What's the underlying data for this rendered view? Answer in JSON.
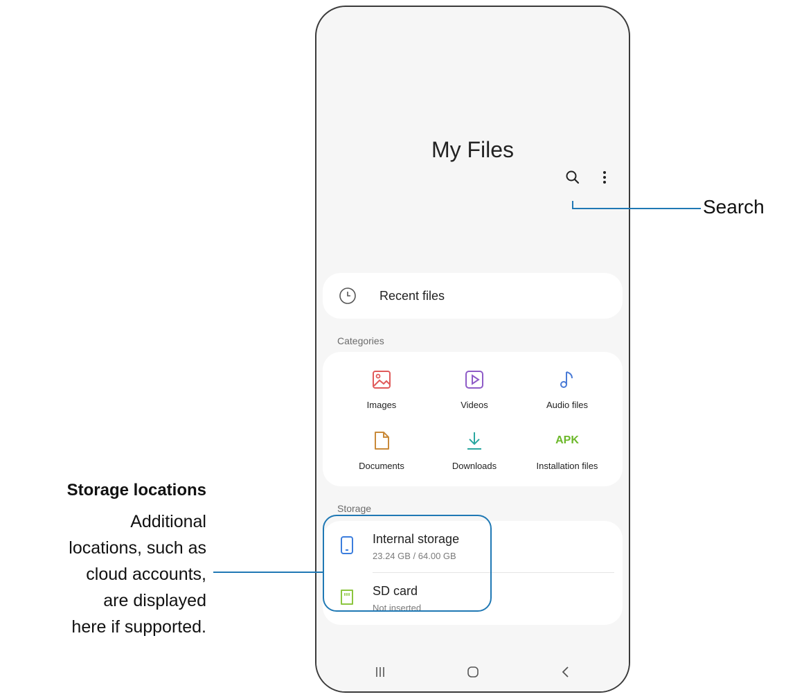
{
  "app": {
    "title": "My Files"
  },
  "toolbar": {
    "search_icon": "search-icon",
    "more_icon": "more-options-icon"
  },
  "recent": {
    "label": "Recent files",
    "icon": "clock-icon"
  },
  "categories": {
    "heading": "Categories",
    "items": [
      {
        "label": "Images",
        "icon": "image-icon",
        "color": "#e05a5a"
      },
      {
        "label": "Videos",
        "icon": "video-icon",
        "color": "#8e5bc7"
      },
      {
        "label": "Audio files",
        "icon": "music-note-icon",
        "color": "#4a7bd6"
      },
      {
        "label": "Documents",
        "icon": "document-icon",
        "color": "#c98a3a"
      },
      {
        "label": "Downloads",
        "icon": "download-icon",
        "color": "#2aa7a0"
      },
      {
        "label": "Installation files",
        "icon_text": "APK",
        "color": "#6cb82a"
      }
    ]
  },
  "storage": {
    "heading": "Storage",
    "items": [
      {
        "name": "Internal storage",
        "detail": "23.24 GB / 64.00 GB",
        "icon": "phone-icon",
        "color": "#3b7ddd"
      },
      {
        "name": "SD card",
        "detail": "Not inserted",
        "icon": "sd-card-icon",
        "color": "#8cc63f"
      }
    ]
  },
  "nav": {
    "recents": "recents-icon",
    "home": "home-icon",
    "back": "back-icon"
  },
  "callouts": {
    "search": "Search",
    "storage_title": "Storage locations",
    "storage_desc": [
      "Additional",
      "locations, such as",
      "cloud accounts,",
      "are displayed",
      "here if supported."
    ]
  },
  "colors": {
    "accent": "#1f78b4",
    "background": "#f6f6f6",
    "card": "#ffffff"
  }
}
